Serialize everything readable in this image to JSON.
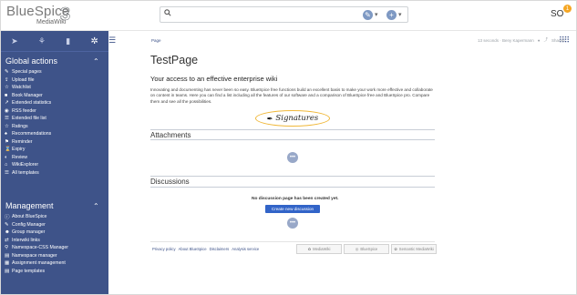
{
  "brand": {
    "name": "BlueSpice",
    "version": "3",
    "sub": "MediaWiki"
  },
  "header": {
    "search_placeholder": "",
    "user_initials": "SO",
    "notification_count": "1"
  },
  "sidebar": {
    "global_title": "Global actions",
    "global_items": [
      {
        "icon": "✎",
        "label": "Special pages"
      },
      {
        "icon": "⇪",
        "label": "Upload file"
      },
      {
        "icon": "☆",
        "label": "Watchlist"
      },
      {
        "icon": "■",
        "label": "Book Manager"
      },
      {
        "icon": "↗",
        "label": "Extended statistics"
      },
      {
        "icon": "◉",
        "label": "RSS feeder"
      },
      {
        "icon": "☰",
        "label": "Extended file list"
      },
      {
        "icon": "☆",
        "label": "Ratings"
      },
      {
        "icon": "♠",
        "label": "Recommendations"
      },
      {
        "icon": "⚑",
        "label": "Reminder"
      },
      {
        "icon": "⌛",
        "label": "Expiry"
      },
      {
        "icon": "◐",
        "label": "Review"
      },
      {
        "icon": "⌂",
        "label": "WikiExplorer"
      },
      {
        "icon": "☰",
        "label": "All templates"
      }
    ],
    "management_title": "Management",
    "management_items": [
      {
        "icon": "ⓘ",
        "label": "About BlueSpice"
      },
      {
        "icon": "✎",
        "label": "Config Manager"
      },
      {
        "icon": "☻",
        "label": "Group manager"
      },
      {
        "icon": "⇄",
        "label": "Interwiki links"
      },
      {
        "icon": "⚲",
        "label": "Namespace-CSS Manager"
      },
      {
        "icon": "▤",
        "label": "Namespace manager"
      },
      {
        "icon": "▦",
        "label": "Assignment management"
      },
      {
        "icon": "▤",
        "label": "Page templates"
      }
    ]
  },
  "page": {
    "tab": "Page",
    "meta_time": "13 seconds · Beny Kapermann",
    "meta_shared": "Shared",
    "title": "TestPage",
    "subtitle": "Your access to an effective enterprise wiki",
    "intro": "Innovating and documenting has never been so easy. BlueSpice free functions build an excellent basis to make your work more effective and collaborate on content in teams. Here you can find a list including all the features of our software and a comparison of BlueSpice free and BlueSpice pro. Compare them and see all the possibilities.",
    "signatures_label": "Signatures",
    "attachments_title": "Attachments",
    "discussions_title": "Discussions",
    "no_discussion_text": "No discussion page has been created yet.",
    "create_discussion_label": "Create new discussion"
  },
  "footer": {
    "links": [
      "Privacy policy",
      "About BlueSpice",
      "Disclaimers",
      "Analysis service"
    ],
    "badge_mediawiki": "MediaWiki",
    "badge_bluespice": "BlueSpice",
    "badge_semantic": "Semantic MediaWiki"
  },
  "colors": {
    "sidebar": "#3e5389",
    "accent": "#3264c8",
    "highlight": "#f0b83a"
  }
}
